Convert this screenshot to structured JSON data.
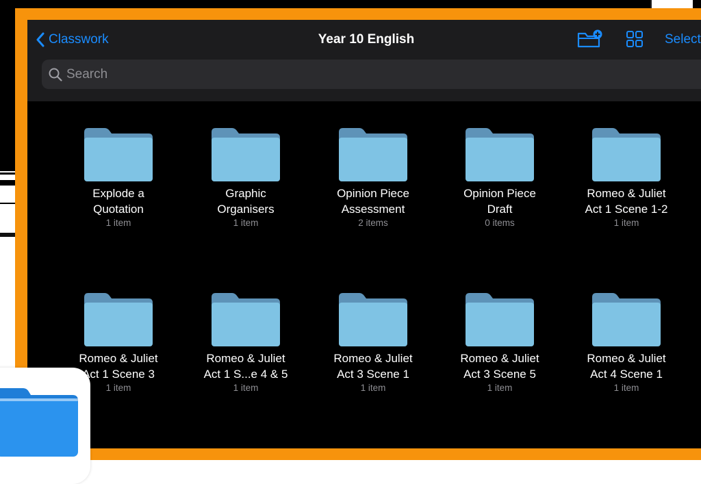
{
  "header": {
    "back_label": "Classwork",
    "title": "Year 10 English",
    "select_label": "Select"
  },
  "search": {
    "placeholder": "Search"
  },
  "folders": [
    {
      "line1": "Explode a",
      "line2": "Quotation",
      "count": "1 item"
    },
    {
      "line1": "Graphic",
      "line2": "Organisers",
      "count": "1 item"
    },
    {
      "line1": "Opinion Piece",
      "line2": "Assessment",
      "count": "2 items"
    },
    {
      "line1": "Opinion Piece",
      "line2": "Draft",
      "count": "0 items"
    },
    {
      "line1": "Romeo & Juliet",
      "line2": "Act 1 Scene 1-2",
      "count": "1 item"
    },
    {
      "line1": "Romeo & Juliet",
      "line2": "Act 1 Scene 3",
      "count": "1 item"
    },
    {
      "line1": "Romeo & Juliet",
      "line2": "Act 1 S...e 4 & 5",
      "count": "1 item"
    },
    {
      "line1": "Romeo & Juliet",
      "line2": "Act 3 Scene 1",
      "count": "1 item"
    },
    {
      "line1": "Romeo & Juliet",
      "line2": "Act 3 Scene 5",
      "count": "1 item"
    },
    {
      "line1": "Romeo & Juliet",
      "line2": "Act 4 Scene 1",
      "count": "1 item"
    }
  ],
  "icons": {
    "back": "chevron-left-icon",
    "new_folder": "folder-plus-icon",
    "view_mode": "grid-view-icon",
    "search": "magnifier-icon",
    "folder": "folder-icon",
    "app": "files-app-icon"
  },
  "colors": {
    "accent": "#1a8cff",
    "frame": "#f7930c",
    "header_bg": "#1c1c1e",
    "folder_body": "#7fc3e4",
    "folder_tab": "#5e93b8"
  }
}
